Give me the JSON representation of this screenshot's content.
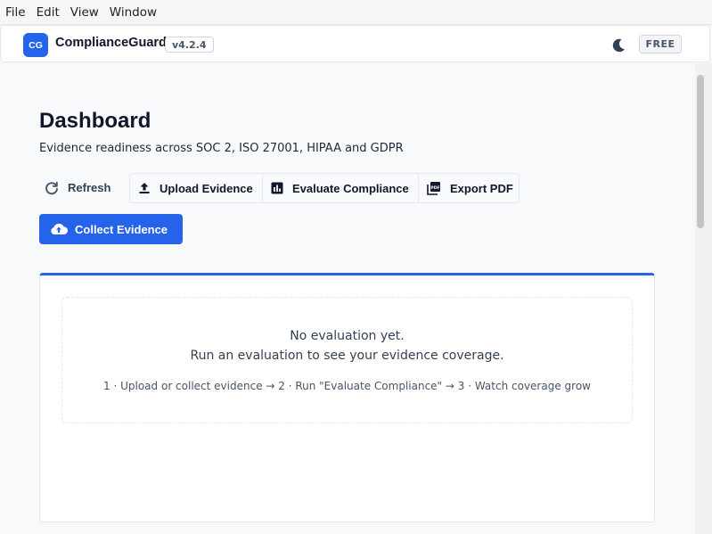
{
  "menu": [
    "File",
    "Edit",
    "View",
    "Window"
  ],
  "header": {
    "logo_text": "CG",
    "app_name": "ComplianceGuard",
    "version": "v4.2.4",
    "plan_badge": "FREE"
  },
  "main": {
    "title": "Dashboard",
    "subtitle": "Evidence readiness across SOC 2, ISO 27001, HIPAA and GDPR",
    "actions": {
      "refresh": "Refresh",
      "upload": "Upload Evidence",
      "evaluate": "Evaluate Compliance",
      "export": "Export PDF",
      "collect": "Collect Evidence"
    },
    "empty_state": {
      "line1": "No evaluation yet.",
      "line2": "Run an evaluation to see your evidence coverage.",
      "steps": "1 · Upload or collect evidence  →  2 · Run \"Evaluate Compliance\"  →  3 · Watch coverage grow"
    }
  },
  "colors": {
    "accent": "#2563eb",
    "text": "#0f172a",
    "muted": "#475569"
  },
  "icons": {
    "theme": "moon-icon",
    "refresh": "refresh-icon",
    "upload": "upload-icon",
    "evaluate": "chart-icon",
    "export": "pdf-icon",
    "collect": "cloud-upload-icon"
  }
}
